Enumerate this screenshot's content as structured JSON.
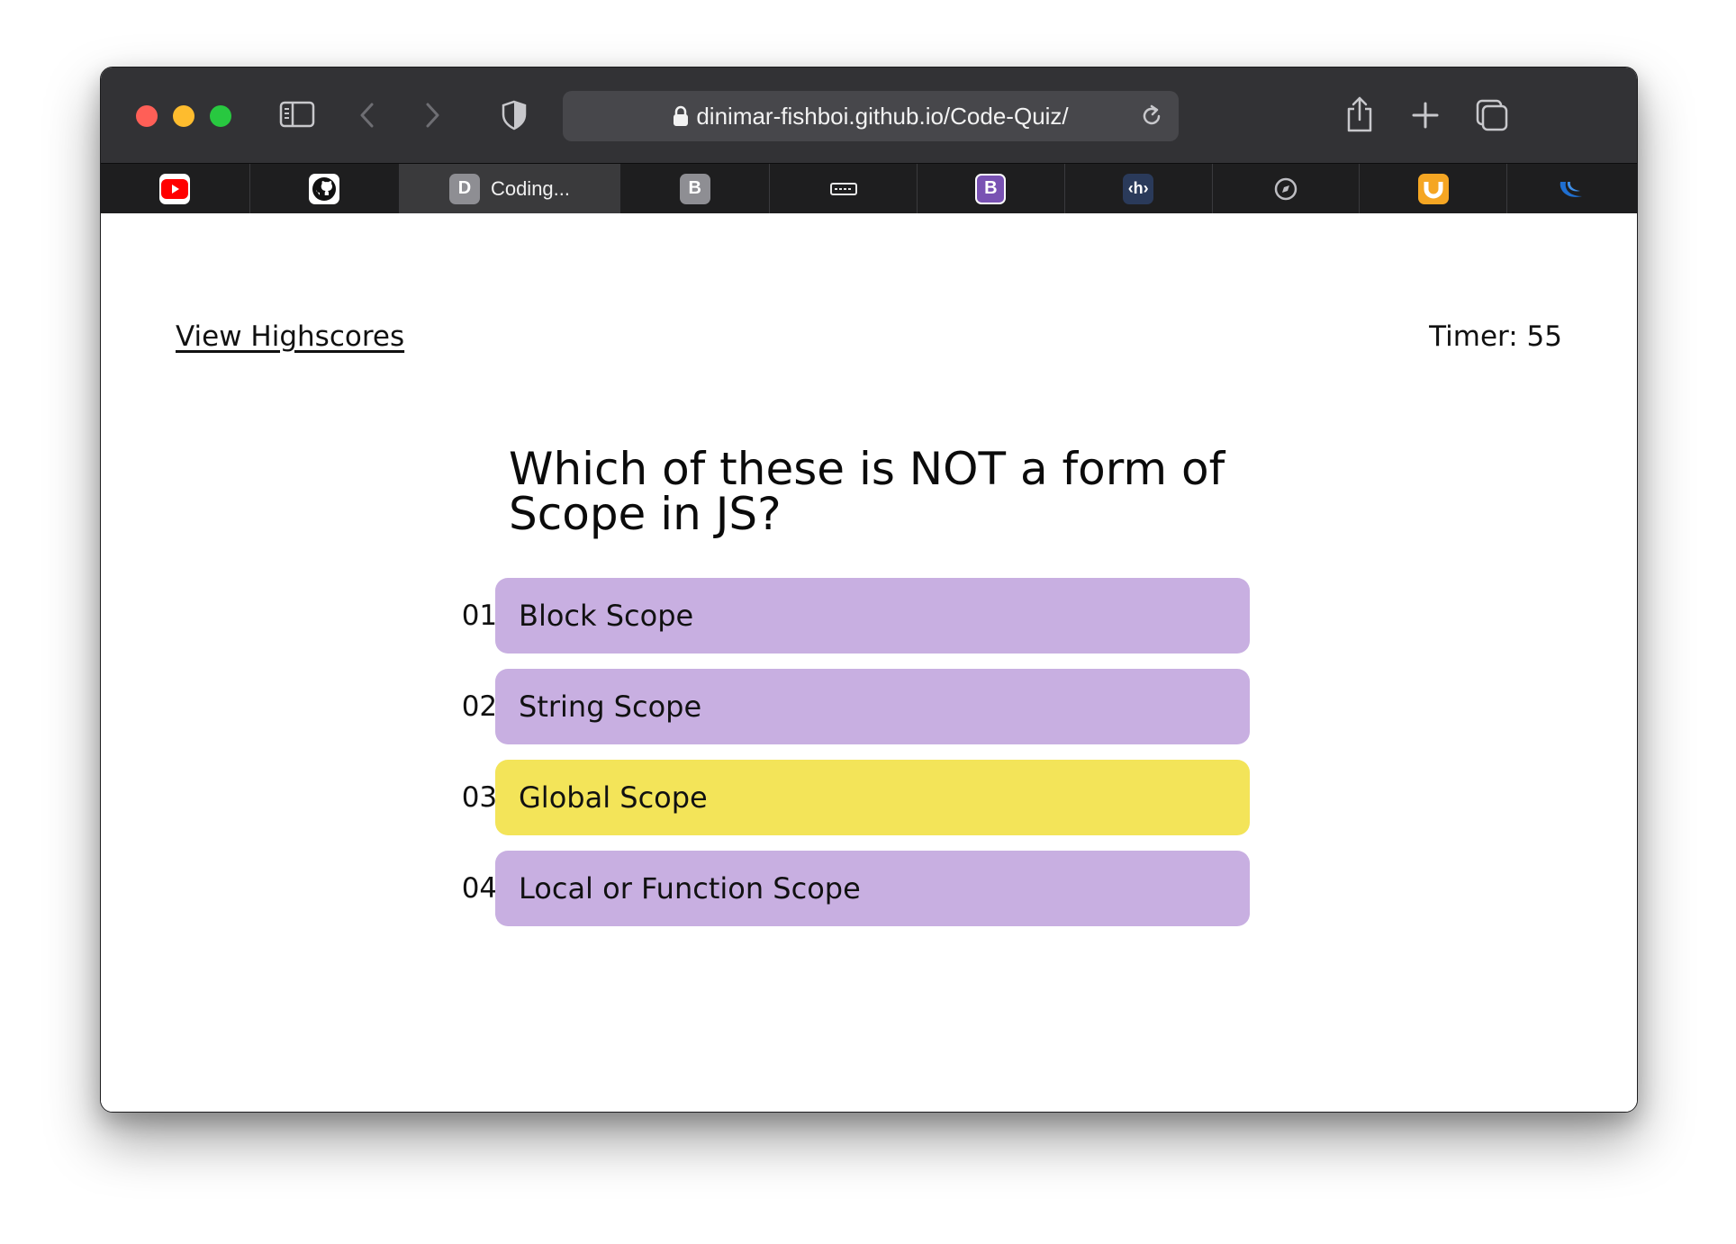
{
  "browser": {
    "url": "dinimar-fishboi.github.io/Code-Quiz/",
    "tabs": [
      {
        "favicon": "youtube-icon",
        "title": ""
      },
      {
        "favicon": "github-icon",
        "title": ""
      },
      {
        "favicon_letter": "D",
        "title": "Coding..."
      },
      {
        "favicon_letter": "B",
        "title": ""
      },
      {
        "favicon": "dark-mode-icon",
        "title": ""
      },
      {
        "favicon_letter": "B",
        "title": ""
      },
      {
        "favicon_letter": "‹h›",
        "title": ""
      },
      {
        "favicon": "compass-icon",
        "title": ""
      },
      {
        "favicon": "magnet-icon",
        "title": ""
      },
      {
        "favicon": "jquery-icon",
        "title": ""
      }
    ]
  },
  "header": {
    "highscores_label": "View Highscores",
    "timer_label": "Timer: ",
    "timer_value": "55"
  },
  "question": {
    "text": "Which of these is NOT a form of Scope in JS?"
  },
  "answers": [
    {
      "number": "01.",
      "label": "Block Scope",
      "selected": false
    },
    {
      "number": "02.",
      "label": "String Scope",
      "selected": false
    },
    {
      "number": "03.",
      "label": "Global Scope",
      "selected": true
    },
    {
      "number": "04.",
      "label": "Local or Function Scope",
      "selected": false
    }
  ],
  "colors": {
    "answer_default": "#c8afe1",
    "answer_selected": "#f3e459"
  }
}
